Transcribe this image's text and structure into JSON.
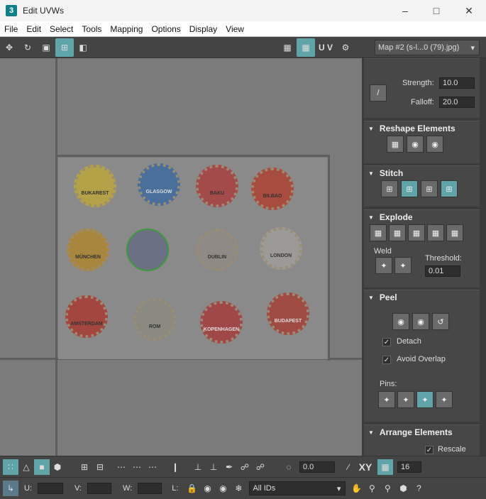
{
  "window": {
    "title": "Edit UVWs",
    "icon_text": "3"
  },
  "menu": [
    "File",
    "Edit",
    "Select",
    "Tools",
    "Mapping",
    "Options",
    "Display",
    "View"
  ],
  "toolbar": {
    "uv_label": "U V",
    "map_select": "Map #2 (s-l...0 (79).jpg)"
  },
  "caps": [
    "BUKAREST",
    "GLASGOW",
    "BAKU",
    "BILBAO",
    "MÜNCHEN",
    "",
    "DUBLIN",
    "LONDON",
    "AMSTERDAM",
    "ROM",
    "KOPENHAGEN",
    "BUDAPEST"
  ],
  "panel": {
    "strength_label": "Strength:",
    "strength_value": "10.0",
    "falloff_label": "Falloff:",
    "falloff_value": "20.0",
    "reshape_title": "Reshape Elements",
    "stitch_title": "Stitch",
    "explode_title": "Explode",
    "weld_label": "Weld",
    "threshold_label": "Threshold:",
    "threshold_value": "0.01",
    "peel_title": "Peel",
    "detach_label": "Detach",
    "avoid_overlap_label": "Avoid Overlap",
    "pins_label": "Pins:",
    "arrange_title": "Arrange Elements",
    "rescale_label": "Rescale"
  },
  "bottom": {
    "rotate_value": "0.0",
    "xy_label": "XY",
    "grid_value": "16",
    "u_label": "U:",
    "v_label": "V:",
    "w_label": "W:",
    "l_label": "L:",
    "ids_value": "All IDs"
  }
}
